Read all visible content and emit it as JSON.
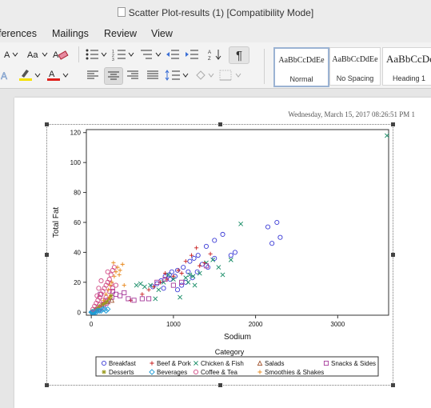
{
  "window": {
    "title": "Scatter Plot-results (1) [Compatibility Mode]"
  },
  "menu": [
    "ferences",
    "Mailings",
    "Review",
    "View"
  ],
  "ribbon": {
    "styles": [
      {
        "preview": "AaBbCcDdEe",
        "name": "Normal",
        "selected": true
      },
      {
        "preview": "AaBbCcDdEe",
        "name": "No Spacing",
        "selected": false
      },
      {
        "preview": "AaBbCcDc",
        "name": "Heading 1",
        "selected": false
      }
    ],
    "colors": {
      "highlight": "#f5e100",
      "font_color": "#e0201b"
    }
  },
  "document": {
    "header": "Wednesday, March 15, 2017 08:26:51 PM  1"
  },
  "chart_data": {
    "type": "scatter",
    "xlabel": "Sodium",
    "ylabel": "Total Fat",
    "xlim": [
      -60,
      3620
    ],
    "ylim": [
      -2,
      122
    ],
    "xticks": [
      0,
      1000,
      2000,
      3000
    ],
    "yticks": [
      0,
      20,
      40,
      60,
      80,
      100,
      120
    ],
    "legend": {
      "title": "Category",
      "placement": "bottom"
    },
    "series": [
      {
        "name": "Breakfast",
        "marker": "circle",
        "color": "#3b3bd6",
        "points": [
          [
            750,
            17
          ],
          [
            800,
            19
          ],
          [
            850,
            21
          ],
          [
            900,
            24
          ],
          [
            950,
            25
          ],
          [
            980,
            27
          ],
          [
            1050,
            28
          ],
          [
            1120,
            30
          ],
          [
            1200,
            34
          ],
          [
            1250,
            36
          ],
          [
            1300,
            38
          ],
          [
            1400,
            44
          ],
          [
            1500,
            48
          ],
          [
            1600,
            52
          ],
          [
            1700,
            38
          ],
          [
            1750,
            40
          ],
          [
            2150,
            57
          ],
          [
            2260,
            60
          ],
          [
            2300,
            50
          ],
          [
            2200,
            46
          ],
          [
            1150,
            20
          ],
          [
            1230,
            23
          ],
          [
            1290,
            27
          ],
          [
            1350,
            32
          ],
          [
            1420,
            30
          ],
          [
            1500,
            36
          ],
          [
            1050,
            15
          ],
          [
            1100,
            18
          ],
          [
            880,
            16
          ],
          [
            960,
            22
          ],
          [
            1020,
            24
          ],
          [
            1180,
            27
          ]
        ]
      },
      {
        "name": "Beef & Pork",
        "marker": "plus",
        "color": "#c81e1e",
        "points": [
          [
            480,
            8
          ],
          [
            620,
            12
          ],
          [
            700,
            15
          ],
          [
            760,
            17
          ],
          [
            840,
            20
          ],
          [
            920,
            22
          ],
          [
            1000,
            24
          ],
          [
            1060,
            28
          ],
          [
            1150,
            34
          ],
          [
            1220,
            38
          ],
          [
            1280,
            43
          ],
          [
            1380,
            33
          ],
          [
            1450,
            39
          ],
          [
            1320,
            31
          ],
          [
            900,
            26
          ],
          [
            1100,
            26
          ]
        ]
      },
      {
        "name": "Chicken & Fish",
        "marker": "x",
        "color": "#138a63",
        "points": [
          [
            550,
            18
          ],
          [
            600,
            19
          ],
          [
            650,
            17
          ],
          [
            720,
            18
          ],
          [
            780,
            9
          ],
          [
            820,
            15
          ],
          [
            880,
            20
          ],
          [
            940,
            25
          ],
          [
            1000,
            22
          ],
          [
            1080,
            10
          ],
          [
            1150,
            23
          ],
          [
            1200,
            25
          ],
          [
            1260,
            18
          ],
          [
            1320,
            26
          ],
          [
            1400,
            33
          ],
          [
            1480,
            35
          ],
          [
            1550,
            30
          ],
          [
            1600,
            25
          ],
          [
            1820,
            59
          ],
          [
            3600,
            118
          ],
          [
            1700,
            35
          ],
          [
            1180,
            20
          ],
          [
            1240,
            24
          ]
        ]
      },
      {
        "name": "Salads",
        "marker": "triangle",
        "color": "#a0522d",
        "points": [
          [
            50,
            2
          ],
          [
            100,
            3
          ],
          [
            130,
            5
          ],
          [
            200,
            7
          ],
          [
            250,
            8
          ]
        ]
      },
      {
        "name": "Snacks & Sides",
        "marker": "square",
        "color": "#a63a9b",
        "points": [
          [
            20,
            0
          ],
          [
            60,
            1
          ],
          [
            90,
            2
          ],
          [
            120,
            3
          ],
          [
            150,
            5
          ],
          [
            200,
            8
          ],
          [
            250,
            10
          ],
          [
            300,
            12
          ],
          [
            350,
            11
          ],
          [
            400,
            13
          ],
          [
            450,
            9
          ],
          [
            520,
            8
          ],
          [
            620,
            9
          ],
          [
            700,
            9
          ],
          [
            800,
            20
          ],
          [
            900,
            22
          ],
          [
            1000,
            18
          ],
          [
            1100,
            20
          ],
          [
            1400,
            31
          ],
          [
            110,
            12
          ],
          [
            180,
            6
          ],
          [
            260,
            14
          ]
        ]
      },
      {
        "name": "Desserts",
        "marker": "star",
        "color": "#9a9a1e",
        "points": [
          [
            10,
            0
          ],
          [
            30,
            1
          ],
          [
            60,
            2
          ],
          [
            80,
            3
          ],
          [
            100,
            4
          ],
          [
            130,
            5
          ],
          [
            160,
            6
          ],
          [
            190,
            7
          ],
          [
            220,
            9
          ],
          [
            240,
            11
          ]
        ]
      },
      {
        "name": "Beverages",
        "marker": "diamond",
        "color": "#1e9bd6",
        "points": [
          [
            0,
            0
          ],
          [
            10,
            0
          ],
          [
            20,
            0
          ],
          [
            30,
            0
          ],
          [
            40,
            0
          ],
          [
            50,
            1
          ],
          [
            60,
            0
          ],
          [
            80,
            1
          ],
          [
            100,
            1
          ],
          [
            120,
            1
          ],
          [
            140,
            2
          ],
          [
            160,
            2
          ],
          [
            180,
            1
          ],
          [
            200,
            2
          ]
        ]
      },
      {
        "name": "Coffee & Tea",
        "marker": "circle",
        "color": "#d14a85",
        "points": [
          [
            20,
            2
          ],
          [
            40,
            4
          ],
          [
            60,
            6
          ],
          [
            80,
            8
          ],
          [
            100,
            10
          ],
          [
            120,
            12
          ],
          [
            140,
            14
          ],
          [
            160,
            16
          ],
          [
            180,
            18
          ],
          [
            200,
            20
          ],
          [
            220,
            22
          ],
          [
            240,
            25
          ],
          [
            260,
            28
          ],
          [
            280,
            30
          ],
          [
            100,
            5
          ],
          [
            140,
            8
          ],
          [
            180,
            10
          ],
          [
            220,
            14
          ],
          [
            260,
            16
          ],
          [
            300,
            18
          ],
          [
            200,
            27
          ],
          [
            240,
            19
          ],
          [
            120,
            21
          ],
          [
            90,
            16
          ],
          [
            70,
            11
          ]
        ]
      },
      {
        "name": "Smoothies & Shakes",
        "marker": "plus",
        "color": "#e8881c",
        "points": [
          [
            150,
            8
          ],
          [
            180,
            12
          ],
          [
            210,
            15
          ],
          [
            230,
            18
          ],
          [
            250,
            20
          ],
          [
            280,
            24
          ],
          [
            300,
            27
          ],
          [
            320,
            30
          ],
          [
            350,
            28
          ],
          [
            380,
            32
          ],
          [
            400,
            18
          ],
          [
            340,
            25
          ],
          [
            270,
            33
          ],
          [
            220,
            10
          ]
        ]
      }
    ]
  }
}
